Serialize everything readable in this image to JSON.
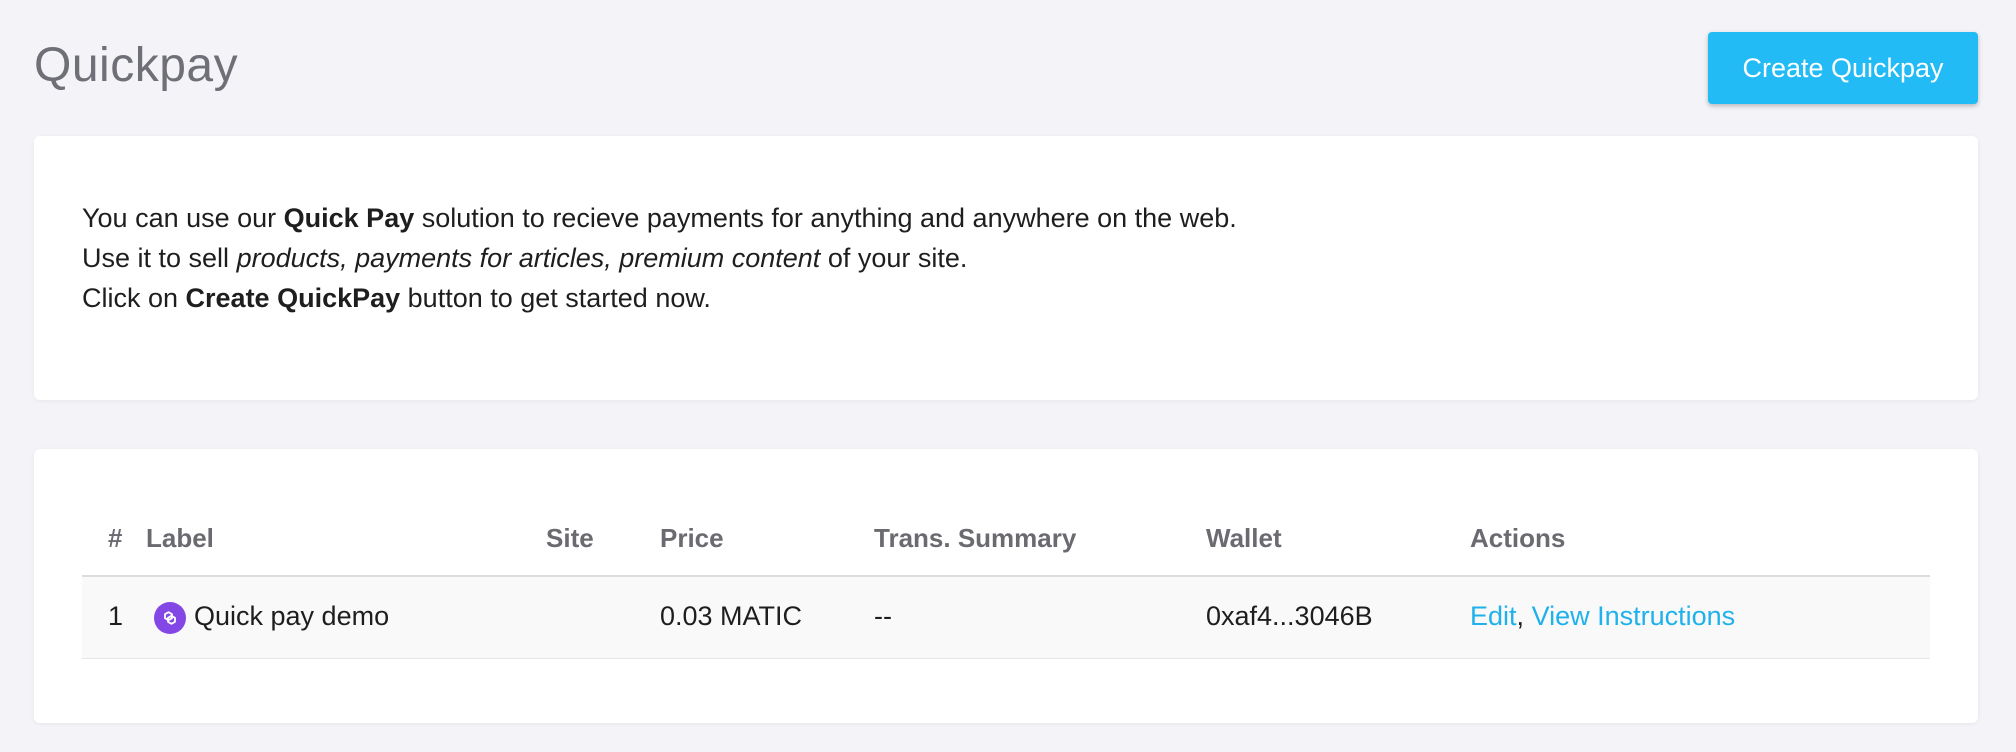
{
  "header": {
    "title": "Quickpay",
    "create_button": "Create Quickpay"
  },
  "info": {
    "line1_pre": "You can use our ",
    "line1_bold": "Quick Pay",
    "line1_post": " solution to recieve payments for anything and anywhere on the web.",
    "line2_pre": "Use it to sell ",
    "line2_italic": "products, payments for articles, premium content",
    "line2_post": " of your site.",
    "line3_pre": "Click on ",
    "line3_bold": "Create QuickPay",
    "line3_post": " button to get started now."
  },
  "table": {
    "headers": {
      "num": "#",
      "label": "Label",
      "site": "Site",
      "price": "Price",
      "trans": "Trans. Summary",
      "wallet": "Wallet",
      "actions": "Actions"
    },
    "rows": [
      {
        "num": "1",
        "icon": "polygon-matic-icon",
        "label": "Quick pay demo",
        "site": "",
        "price": "0.03 MATIC",
        "trans": "--",
        "wallet": "0xaf4...3046B",
        "edit": "Edit",
        "separator": ",",
        "view": "View Instructions"
      }
    ]
  },
  "colors": {
    "accent": "#22bbf5",
    "link": "#1fb1ec",
    "matic": "#8247e5"
  }
}
